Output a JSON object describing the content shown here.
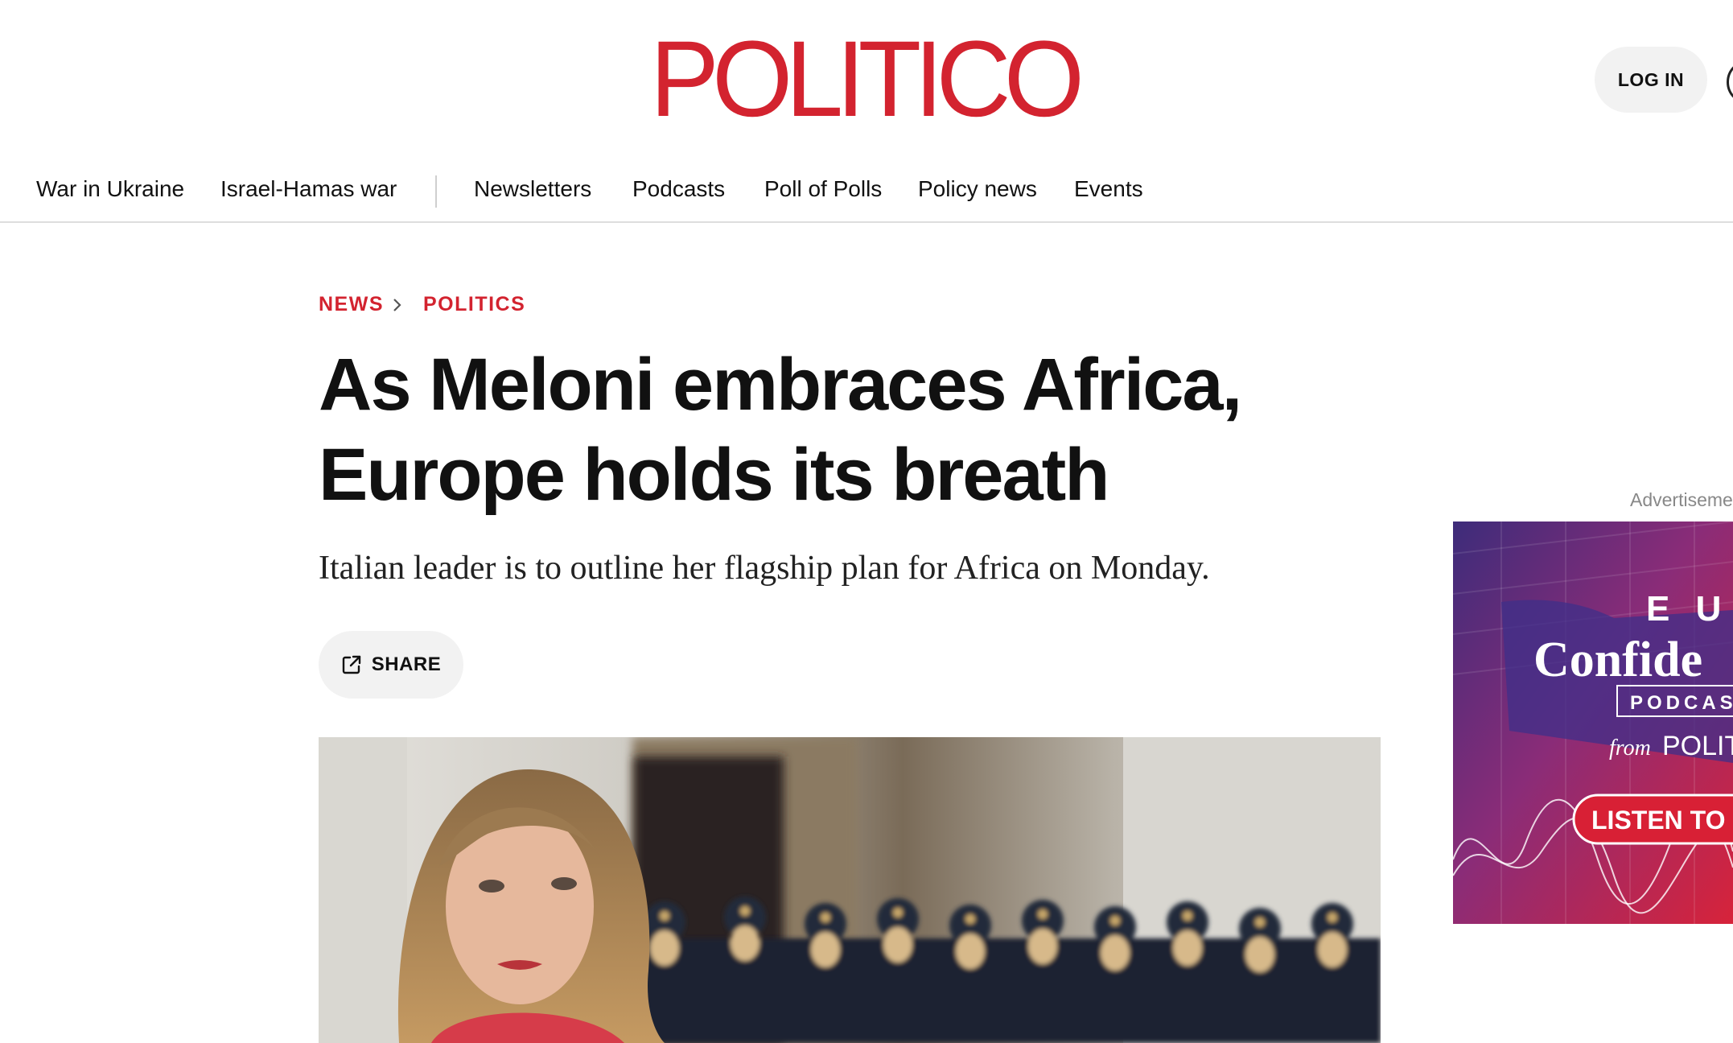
{
  "header": {
    "logo_text": "POLITICO",
    "login_label": "LOG IN"
  },
  "nav": {
    "items": [
      {
        "label": "War in Ukraine"
      },
      {
        "label": "Israel-Hamas war"
      },
      {
        "label": "Newsletters"
      },
      {
        "label": "Podcasts"
      },
      {
        "label": "Poll of Polls"
      },
      {
        "label": "Policy news"
      },
      {
        "label": "Events"
      }
    ]
  },
  "breadcrumb": {
    "items": [
      "NEWS",
      "POLITICS"
    ]
  },
  "article": {
    "headline_line1": "As Meloni embraces Africa,",
    "headline_line2": "Europe holds its breath",
    "dek": "Italian leader is to outline her flagship plan for Africa on Monday.",
    "share_label": "SHARE"
  },
  "ad": {
    "label": "Advertiseme",
    "line1": "E U",
    "line2": "Confide",
    "line3": "PODCAS",
    "line4_prefix": "from",
    "line4_brand": "POLIT",
    "cta": "LISTEN TO"
  },
  "colors": {
    "brand_red": "#d3232f",
    "button_gray": "#f2f2f2",
    "text": "#111111"
  },
  "icons": {
    "breadcrumb_separator": "chevron-right-icon",
    "share": "share-external-icon"
  }
}
